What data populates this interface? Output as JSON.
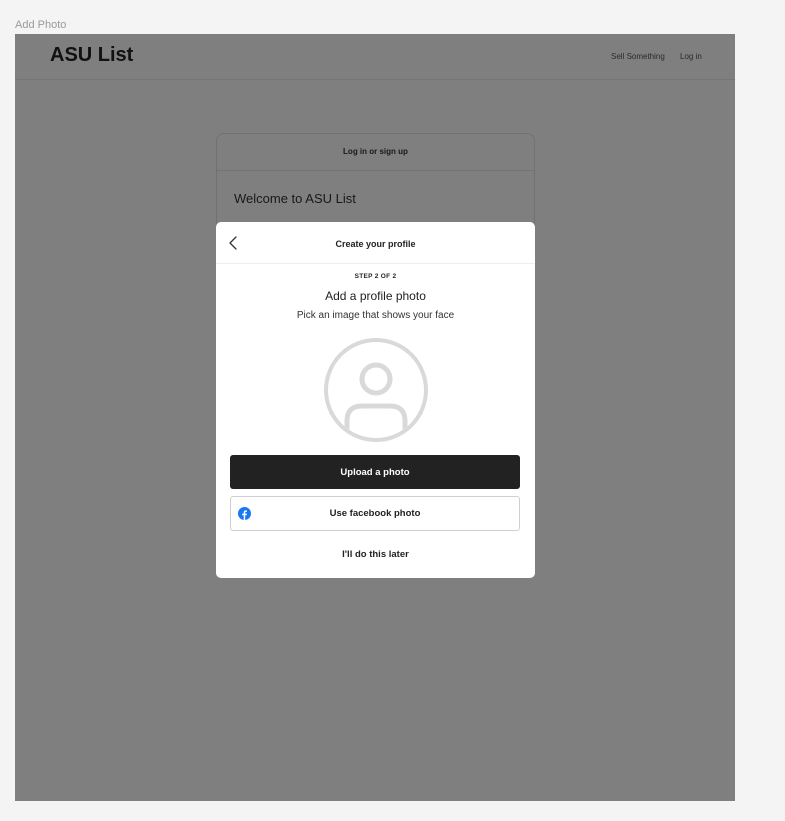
{
  "frame": {
    "label": "Add Photo"
  },
  "header": {
    "logo": "ASU List",
    "nav": {
      "sell": "Sell Something",
      "login": "Log in"
    }
  },
  "background_card": {
    "title": "Log in or sign up",
    "welcome": "Welcome to ASU List"
  },
  "modal": {
    "title": "Create your profile",
    "step": "STEP 2 OF 2",
    "heading": "Add a profile photo",
    "subheading": "Pick an image that shows your face",
    "avatar_icon": "user-avatar-placeholder-icon",
    "upload_label": "Upload a photo",
    "facebook_label": "Use facebook photo",
    "facebook_icon": "facebook-icon",
    "later_label": "I'll do this later"
  },
  "colors": {
    "primary_button": "#222222",
    "facebook_blue": "#1877f2",
    "overlay": "rgba(0,0,0,0.5)"
  }
}
